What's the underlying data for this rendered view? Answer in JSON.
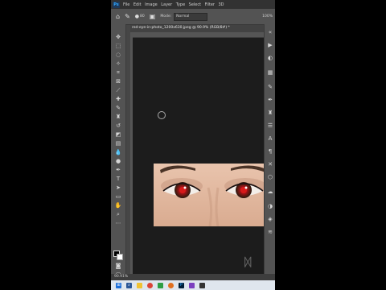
{
  "app": {
    "logo": "Ps"
  },
  "menu": [
    "File",
    "Edit",
    "Image",
    "Layer",
    "Type",
    "Select",
    "Filter",
    "3D"
  ],
  "options_bar": {
    "mode_label": "Mode:",
    "mode_value": "Normal",
    "zoom_short": "100%",
    "brush_size": "80"
  },
  "document_tab": {
    "title": "red-eye-in-photo_1200x630.jpeg @ 90.9% (RGB/8#) *"
  },
  "status_bar": {
    "zoom": "90.91%"
  },
  "colors": {
    "foreground": "#000000",
    "background": "#ffffff",
    "accent": "#31a8ff"
  }
}
